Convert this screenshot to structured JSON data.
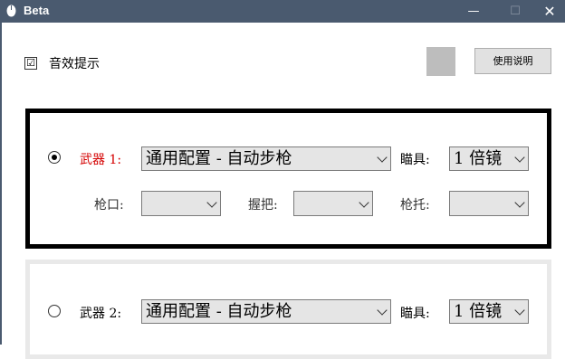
{
  "window": {
    "title": "Beta",
    "min": "—",
    "max": "☐",
    "close": "✕"
  },
  "settings": {
    "sound_label": "音效提示",
    "sound_checked": "☑",
    "help_label": "使用说明",
    "swatch_color": "#bdbdbd"
  },
  "weapons": [
    {
      "label": "武器 1:",
      "selected": true,
      "config": "通用配置 - 自动步枪",
      "scope_label": "瞄具:",
      "scope": "1 倍镜",
      "muzzle_label": "枪口:",
      "grip_label": "握把:",
      "stock_label": "枪托:"
    },
    {
      "label": "武器 2:",
      "selected": false,
      "config": "通用配置 - 自动步枪",
      "scope_label": "瞄具:",
      "scope": "1 倍镜"
    }
  ]
}
